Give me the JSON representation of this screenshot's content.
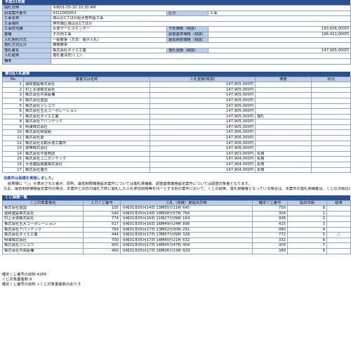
{
  "title_bar": "平成31年度",
  "info": {
    "rows": [
      {
        "label": "開札日時",
        "value": "令和01-05-20 10:30 AM"
      },
      {
        "label": "調達案件番号",
        "value": "4311000053",
        "label2": "区分",
        "value2": "工事"
      },
      {
        "label": "工事名称",
        "value": "城山台1丁ほか配水管布設工事"
      },
      {
        "label": "工事場所",
        "value": "堺市南区城山台1丁ほか"
      },
      {
        "label": "工事担当課",
        "value": "水道サービスセンター",
        "label2": "予定価格（税抜）",
        "value2": "183,606,000円"
      },
      {
        "label": "業種",
        "value": "その他工事",
        "label2": "調査基準価格（税抜）",
        "value2": "166,421,000円"
      },
      {
        "label": "入札契約方式",
        "value": "一般競争（方法：電子入札）",
        "label2": "最低制限価格（税抜）",
        "value2": ""
      },
      {
        "label": "落札方式区分",
        "value": "価格競争"
      },
      {
        "label": "落札者名",
        "value": "株式会社ダイエ工業",
        "label2": "落札金額（税抜）",
        "value2": "147,905,000円"
      },
      {
        "label": "入札結果",
        "value": "落札者決定(くじ)"
      },
      {
        "label": "備考",
        "value": ""
      }
    ]
  },
  "round1": {
    "title": "第1回入札結果",
    "headers": [
      "No",
      "業者又は名称",
      "入札金額(税抜)",
      "摘要",
      "状況"
    ],
    "rows": [
      {
        "no": "1",
        "name": "堀和建設株式会社",
        "amount": "147,905,000円",
        "memo": ""
      },
      {
        "no": "2",
        "name": "村上水道株式会社",
        "amount": "147,905,000円",
        "memo": ""
      },
      {
        "no": "3",
        "name": "株式会社共栄設備",
        "amount": "147,905,000円",
        "memo": ""
      },
      {
        "no": "4",
        "name": "株式会社豊国",
        "amount": "147,905,000円",
        "memo": ""
      },
      {
        "no": "5",
        "name": "株式会社ジシユウ",
        "amount": "147,905,000円",
        "memo": ""
      },
      {
        "no": "6",
        "name": "株式会社五大コーポレーション",
        "amount": "147,905,000円",
        "memo": ""
      },
      {
        "no": "7",
        "name": "株式会社ダイエ工業",
        "amount": "147,905,000円",
        "memo": "落札"
      },
      {
        "no": "8",
        "name": "株式会社アパンテック",
        "amount": "147,905,000円",
        "memo": ""
      },
      {
        "no": "9",
        "name": "明澤株式会社",
        "amount": "147,905,000円",
        "memo": ""
      },
      {
        "no": "10",
        "name": "株式会社和尾組",
        "amount": "147,906,000円",
        "memo": ""
      },
      {
        "no": "11",
        "name": "株式会社豊",
        "amount": "147,906,000円",
        "memo": ""
      },
      {
        "no": "12",
        "name": "株式会社北勘水道工業所",
        "amount": "147,906,000円",
        "memo": ""
      },
      {
        "no": "13",
        "name": "栄伸株式会社",
        "amount": "147,906,000円",
        "memo": ""
      },
      {
        "no": "14",
        "name": "株式会社今豊商店",
        "amount": "147,903,000円",
        "memo": "失格"
      },
      {
        "no": "15",
        "name": "株式会社ユニオンテック",
        "amount": "147,904,000円",
        "memo": "失格"
      },
      {
        "no": "16",
        "name": "大池建設興業株式会社",
        "amount": "147,904,000円",
        "memo": "失格"
      },
      {
        "no": "17",
        "name": "株式会社優光",
        "amount": "147,904,000円",
        "memo": "失格"
      }
    ]
  },
  "lottery_note": {
    "heading": "当案件は抽選を実施しました。",
    "paragraphs": [
      "結果欄に「○」が表示された者が、原則、最低制限価格設定案件については落札候補者、調査基準価格設定案件については調査対象者となります。",
      "なお、最低制限価格設定案件の場合、本案件と同日の開札で既に開札した入札参加資格等を同一とする他の案件において、くじの結果、落札候補者となっている場合は、本案件の落札候補者は、くじの次順位の者となります。ただし、くじの次順位者も先のくじ案件で既に落札候補者となっており、他にくじ対象者がいない場合は、くじに当選した者を落札候補者とします。"
    ]
  },
  "lottery": {
    "title": "くじ抽選一覧",
    "headers": [
      "くじ対象業者名",
      "入力くじ番号",
      "入札（見積）書提出日時",
      "確定くじ番号",
      "提出日順",
      "結果"
    ],
    "rows": [
      {
        "name": "株式会社豊国",
        "input": "105",
        "datetime": "令和01年05月14日 13時55分11秒 645",
        "fixed": "750",
        "order": "8",
        "result": ""
      },
      {
        "name": "堀和建設株式会社",
        "input": "540",
        "datetime": "令和01年05月14日 18時38分57秒 764",
        "fixed": "304",
        "order": "1",
        "result": ""
      },
      {
        "name": "村上水道株式会社",
        "input": "774",
        "datetime": "令和01年05月16日 11時27分09秒 164",
        "fixed": "938",
        "order": "2",
        "result": ""
      },
      {
        "name": "株式会社五大コーポレーション",
        "input": "517",
        "datetime": "令和01年05月16日 16時49分24秒 898",
        "fixed": "415",
        "order": "3",
        "result": ""
      },
      {
        "name": "株式会社アパンテック",
        "input": "789",
        "datetime": "令和01年05月17日 13時52分00秒 291",
        "fixed": "080",
        "order": "4",
        "result": ""
      },
      {
        "name": "株式会社ダイエ工業",
        "input": "444",
        "datetime": "令和01年05月17日 13時57分09秒 328",
        "fixed": "772",
        "order": "5",
        "result": "○"
      },
      {
        "name": "明澤株式会社",
        "input": "700",
        "datetime": "令和01年05月17日 14時40分21秒 632",
        "fixed": "332",
        "order": "6",
        "result": ""
      },
      {
        "name": "株式会社ジシユウ",
        "input": "905",
        "datetime": "令和01年05月17日 14時45分47秒 404",
        "fixed": "309",
        "order": "7",
        "result": ""
      },
      {
        "name": "株式会社共栄設備",
        "input": "460",
        "datetime": "令和01年05月17日 16時06分13秒 929",
        "fixed": "389",
        "order": "8",
        "result": ""
      }
    ]
  },
  "footer": [
    "確定くじ番号の総和:4289",
    "くじ対象業者数:9",
    "確定くじ番号の総和 ÷くじ対象業者数の余り:5"
  ]
}
